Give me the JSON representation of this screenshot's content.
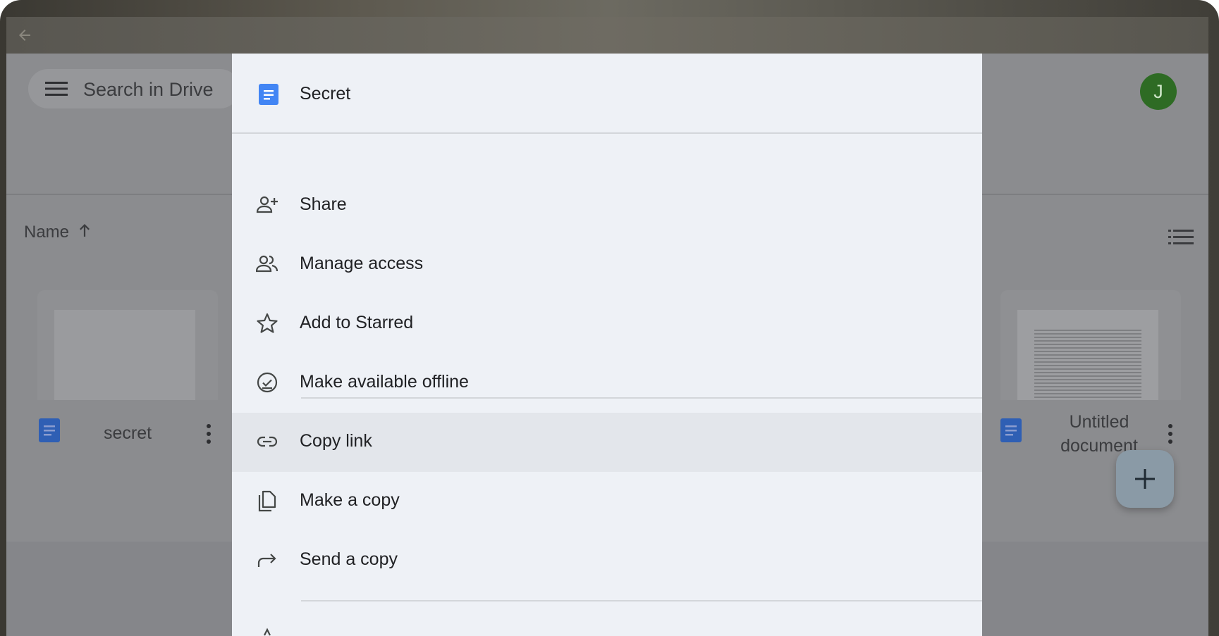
{
  "topbar": {
    "search_label": "Search in Drive",
    "avatar_letter": "J"
  },
  "list": {
    "sort_label": "Name"
  },
  "files": [
    {
      "name": "secret"
    },
    {
      "name_line1": "Untitled",
      "name_line2": "document"
    }
  ],
  "context_menu": {
    "title": "Secret",
    "items": [
      {
        "label": "Share",
        "icon": "person-add-icon"
      },
      {
        "label": "Manage access",
        "icon": "people-icon"
      },
      {
        "label": "Add to Starred",
        "icon": "star-icon"
      },
      {
        "label": "Make available offline",
        "icon": "offline-icon"
      },
      {
        "label": "Copy link",
        "icon": "link-icon",
        "highlighted": true
      },
      {
        "label": "Make a copy",
        "icon": "copy-icon"
      },
      {
        "label": "Send a copy",
        "icon": "forward-icon"
      }
    ]
  },
  "colors": {
    "doc_blue": "#4285f4",
    "avatar_green": "#2e6b24",
    "sheet_bg": "#eef1f6"
  }
}
